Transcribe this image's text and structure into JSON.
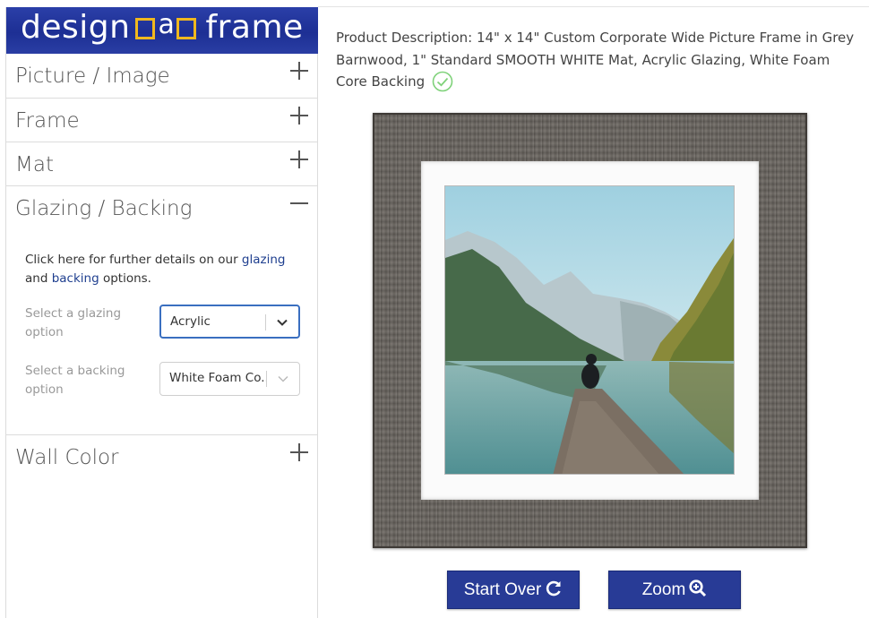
{
  "logo": {
    "left_word": "design",
    "middle_letter": "a",
    "right_word": "frame"
  },
  "accordion": {
    "picture": "Picture / Image",
    "frame": "Frame",
    "mat": "Mat",
    "glazing": "Glazing / Backing",
    "wall": "Wall Color"
  },
  "glazing_panel": {
    "details_prefix": "Click here for further details on our ",
    "glazing_link": "glazing",
    "details_and": " and",
    "backing_link": "backing",
    "details_suffix": " options.",
    "glazing_label": "Select a glazing option",
    "glazing_value": "Acrylic",
    "backing_label": "Select a backing option",
    "backing_value": "White Foam Co..."
  },
  "product": {
    "description": "Product Description: 14\" x 14\" Custom Corporate Wide Picture Frame in Grey Barnwood, 1\" Standard SMOOTH WHITE Mat, Acrylic Glazing, White Foam Core Backing"
  },
  "buttons": {
    "start_over": "Start Over",
    "zoom": "Zoom"
  },
  "colors": {
    "brand_blue": "#283b96",
    "link": "#1f3f8f",
    "check_green": "#7fd27a"
  },
  "icons": {
    "expand": "plus-icon",
    "collapse": "minus-icon",
    "dropdown": "chevron-down-icon",
    "verified": "check-circle-icon",
    "refresh": "refresh-icon",
    "zoom": "zoom-in-icon"
  }
}
